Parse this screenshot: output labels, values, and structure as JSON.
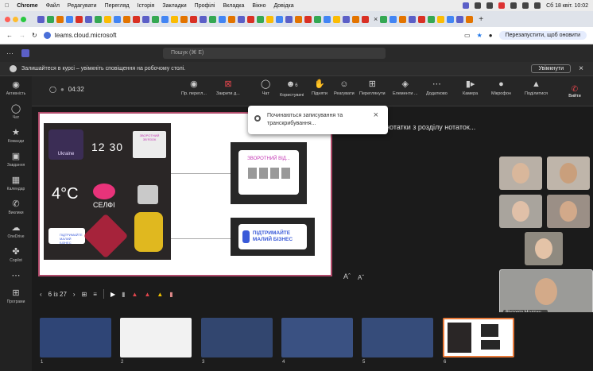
{
  "mac": {
    "app": "Chrome",
    "menu": [
      "Файл",
      "Редагувати",
      "Перегляд",
      "Історія",
      "Закладки",
      "Профілі",
      "Вкладка",
      "Вікно",
      "Довідка"
    ],
    "clock": "Сб 18 квіт. 10:02"
  },
  "browser": {
    "url": "teams.cloud.microsoft",
    "restart": "Перезапустити, щоб оновити"
  },
  "teams": {
    "search_placeholder": "Пошук (⌘ E)",
    "notice": "Залишайтеся в курсі – увімкніть сповіщення на робочому столі.",
    "notice_btn": "Увімкнути"
  },
  "rail": [
    {
      "label": "Активність",
      "icon": "bell-icon"
    },
    {
      "label": "Чат",
      "icon": "chat-icon"
    },
    {
      "label": "Команди",
      "icon": "teams-icon"
    },
    {
      "label": "Завдання",
      "icon": "tasks-icon"
    },
    {
      "label": "Календар",
      "icon": "calendar-icon"
    },
    {
      "label": "Виклики",
      "icon": "phone-icon"
    },
    {
      "label": "OneDrive",
      "icon": "cloud-icon"
    },
    {
      "label": "Copilot",
      "icon": "copilot-icon"
    },
    {
      "label": "",
      "icon": "more-icon"
    },
    {
      "label": "Програми",
      "icon": "apps-icon"
    }
  ],
  "toolbar": {
    "timer": "04:32",
    "items": [
      "Пр. перегл...",
      "Закрити д...",
      "Чат",
      "Користувачі",
      "Підняти",
      "Реагувати",
      "Переглянути",
      "Елементи ...",
      "Додатково",
      "Камера",
      "Мікрофон",
      "Поділитися",
      "Вийти"
    ],
    "people_count": "6"
  },
  "toast": {
    "text": "Починаються записування та транскрибування..."
  },
  "notes_text": "...катимуться нотатки з розділу нотаток...",
  "slide": {
    "stickers": [
      "Ukraine",
      "12 30",
      "ЗВОРОТНИЙ ЗВ'ЯЗОК",
      "4°C",
      "СЕЛФІ",
      "ПІДТРИМАЙТЕ МАЛИЙ БІЗНЕС"
    ],
    "card1": "ЗВОРОТНИЙ ВІД...",
    "card2": "ПІДТРИМАЙТЕ МАЛИЙ БІЗНЕС"
  },
  "controls": {
    "page": "6 із 27"
  },
  "participants": [
    {
      "name": "Вікторія Малтич..."
    }
  ],
  "thumbs": [
    "1",
    "2",
    "3",
    "4",
    "5",
    "6"
  ],
  "colors": {
    "accent": "#5b5fc7",
    "leave": "#c4314b",
    "slide_border": "#b04a6a"
  }
}
